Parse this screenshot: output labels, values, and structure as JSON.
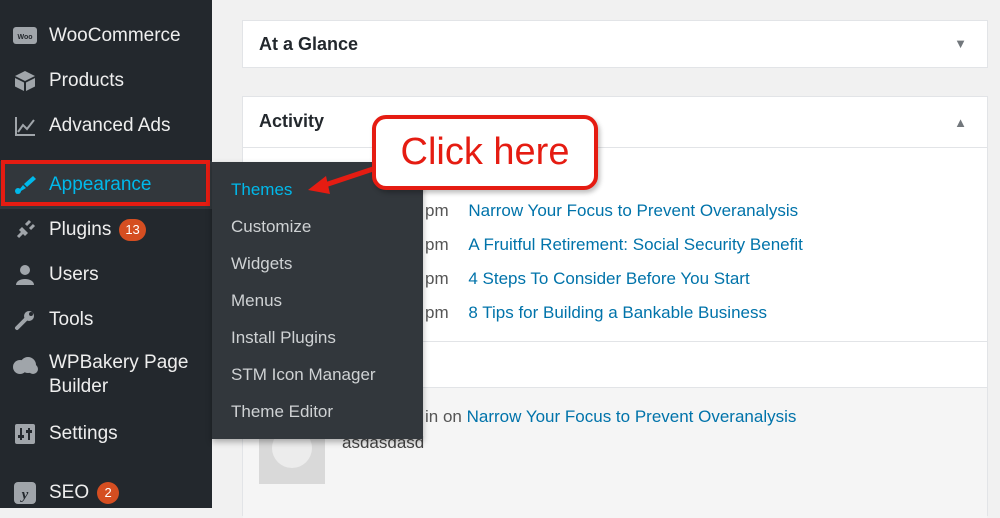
{
  "sidebar": {
    "items": [
      {
        "label": "WooCommerce",
        "icon": "woocommerce-icon"
      },
      {
        "label": "Products",
        "icon": "products-icon"
      },
      {
        "label": "Advanced Ads",
        "icon": "chart-icon"
      },
      {
        "label": "Appearance",
        "icon": "paintbrush-icon"
      },
      {
        "label": "Plugins",
        "icon": "plugin-icon",
        "badge": "13"
      },
      {
        "label": "Users",
        "icon": "users-icon"
      },
      {
        "label": "Tools",
        "icon": "wrench-icon"
      },
      {
        "label": "WPBakery Page",
        "label2": "Builder",
        "icon": "cloud-icon"
      },
      {
        "label": "Settings",
        "icon": "settings-icon"
      },
      {
        "label": "SEO",
        "icon": "yoast-icon",
        "badge": "2"
      }
    ]
  },
  "submenu": {
    "items": [
      "Themes",
      "Customize",
      "Widgets",
      "Menus",
      "Install Plugins",
      "STM Icon Manager",
      "Theme Editor"
    ]
  },
  "panels": {
    "glance_title": "At a Glance",
    "activity_title": "Activity"
  },
  "activity": {
    "rows": [
      {
        "time": "pm",
        "title": "Narrow Your Focus to Prevent Overanalysis"
      },
      {
        "time": "pm",
        "title": "A Fruitful Retirement: Social Security Benefit"
      },
      {
        "time": "pm",
        "title": "4 Steps To Consider Before You Start"
      },
      {
        "time": "pm",
        "title": "8 Tips for Building a Bankable Business"
      }
    ],
    "comment": {
      "author_fragment": "in",
      "on_text": "on",
      "post_title": "Narrow Your Focus to Prevent Overanalysis",
      "text": "asdasdasd"
    }
  },
  "callout": {
    "text": "Click here"
  },
  "colors": {
    "sidebar_bg": "#23282d",
    "accent": "#00b9eb",
    "link": "#0073aa",
    "annotation": "#e51c12"
  }
}
